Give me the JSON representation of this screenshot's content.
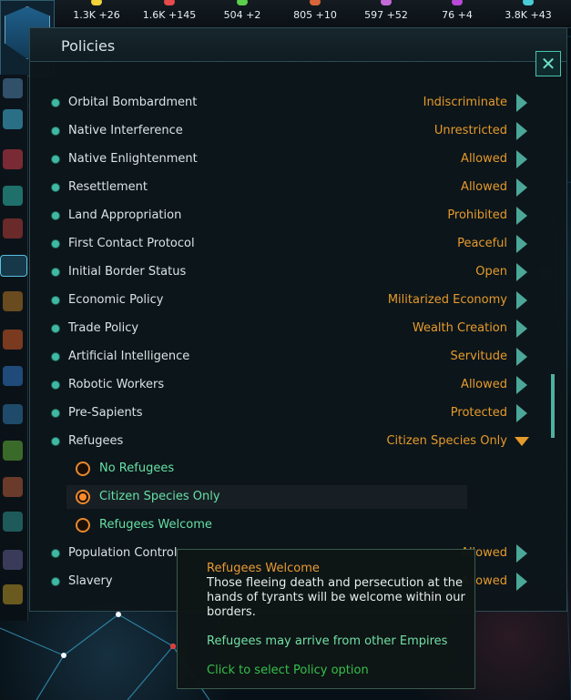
{
  "resources": [
    {
      "name": "energy-icon",
      "value": "1.3K +26",
      "color": "#f2d23b"
    },
    {
      "name": "minerals-icon",
      "value": "1.6K +145",
      "color": "#e64a4a"
    },
    {
      "name": "food-icon",
      "value": "504 +2",
      "color": "#5bd04a"
    },
    {
      "name": "consumer-goods-icon",
      "value": "805 +10",
      "color": "#d8663a"
    },
    {
      "name": "alloys-icon",
      "value": "597 +52",
      "color": "#c46ad8"
    },
    {
      "name": "influence-icon",
      "value": "76 +4",
      "color": "#b84ad8"
    },
    {
      "name": "unity-icon",
      "value": "3.8K +43",
      "color": "#4acbd8"
    }
  ],
  "panel": {
    "title": "Policies",
    "close_icon": "close-x-icon"
  },
  "policies": [
    {
      "name": "Orbital Bombardment",
      "value": "Indiscriminate"
    },
    {
      "name": "Native Interference",
      "value": "Unrestricted"
    },
    {
      "name": "Native Enlightenment",
      "value": "Allowed"
    },
    {
      "name": "Resettlement",
      "value": "Allowed"
    },
    {
      "name": "Land Appropriation",
      "value": "Prohibited"
    },
    {
      "name": "First Contact Protocol",
      "value": "Peaceful"
    },
    {
      "name": "Initial Border Status",
      "value": "Open"
    },
    {
      "name": "Economic Policy",
      "value": "Militarized Economy"
    },
    {
      "name": "Trade Policy",
      "value": "Wealth Creation"
    },
    {
      "name": "Artificial Intelligence",
      "value": "Servitude"
    },
    {
      "name": "Robotic Workers",
      "value": "Allowed"
    },
    {
      "name": "Pre-Sapients",
      "value": "Protected"
    },
    {
      "name": "Refugees",
      "value": "Citizen Species Only"
    },
    {
      "name": "Population Control",
      "value": "Allowed"
    },
    {
      "name": "Slavery",
      "value": "Allowed"
    }
  ],
  "refugee_options": [
    {
      "label": "No Refugees",
      "selected": false
    },
    {
      "label": "Citizen Species Only",
      "selected": true
    },
    {
      "label": "Refugees Welcome",
      "selected": false
    }
  ],
  "tooltip": {
    "title": "Refugees Welcome",
    "description": "Those fleeing death and persecution at the hands of tyrants will be welcome within our borders.",
    "effect": "Refugees may arrive from other Empires",
    "action": "Click to select Policy option"
  }
}
